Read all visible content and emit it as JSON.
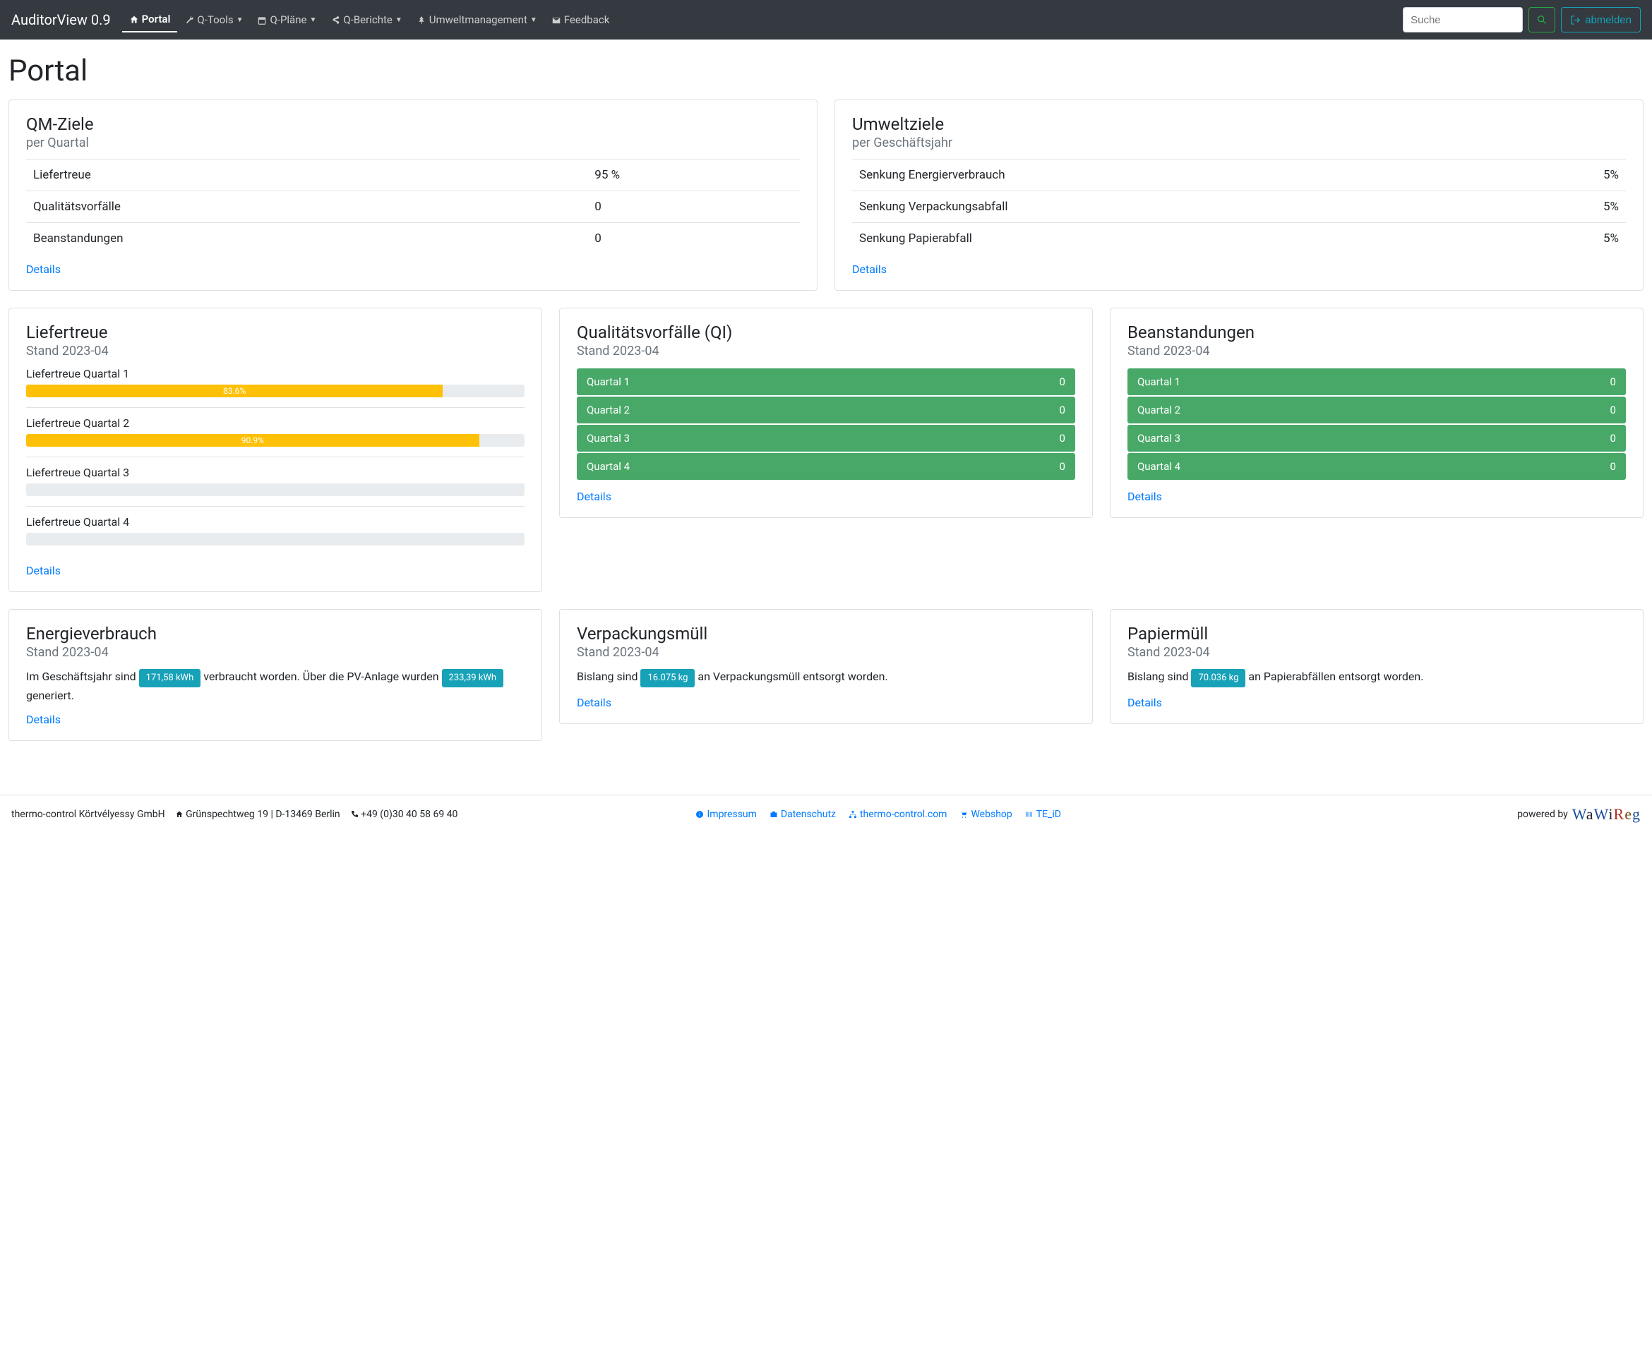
{
  "nav": {
    "brand": "AuditorView 0.9",
    "items": [
      {
        "label": "Portal",
        "icon": "home"
      },
      {
        "label": "Q-Tools",
        "icon": "wrench",
        "dropdown": true
      },
      {
        "label": "Q-Pläne",
        "icon": "calendar",
        "dropdown": true
      },
      {
        "label": "Q-Berichte",
        "icon": "share",
        "dropdown": true
      },
      {
        "label": "Umweltmanagement",
        "icon": "tree",
        "dropdown": true
      },
      {
        "label": "Feedback",
        "icon": "mail"
      }
    ],
    "search_placeholder": "Suche",
    "logout": "abmelden"
  },
  "page_title": "Portal",
  "qm_ziele": {
    "title": "QM-Ziele",
    "subtitle": "per Quartal",
    "rows": [
      {
        "label": "Liefertreue",
        "value": "95 %"
      },
      {
        "label": "Qualitätsvorfälle",
        "value": "0"
      },
      {
        "label": "Beanstandungen",
        "value": "0"
      }
    ],
    "details": "Details"
  },
  "umweltziele": {
    "title": "Umweltziele",
    "subtitle": "per Geschäftsjahr",
    "rows": [
      {
        "label": "Senkung Energierverbrauch",
        "value": "5%"
      },
      {
        "label": "Senkung Verpackungsabfall",
        "value": "5%"
      },
      {
        "label": "Senkung Papierabfall",
        "value": "5%"
      }
    ],
    "details": "Details"
  },
  "liefertreue": {
    "title": "Liefertreue",
    "subtitle": "Stand 2023-04",
    "q1_label": "Liefertreue Quartal 1",
    "q1_pct": 83.6,
    "q1_text": "83.6%",
    "q2_label": "Liefertreue Quartal 2",
    "q2_pct": 90.9,
    "q2_text": "90.9%",
    "q3_label": "Liefertreue Quartal 3",
    "q3_pct": 0,
    "q3_text": "",
    "q4_label": "Liefertreue Quartal 4",
    "q4_pct": 0,
    "q4_text": "",
    "details": "Details"
  },
  "qi": {
    "title": "Qualitätsvorfälle (QI)",
    "subtitle": "Stand 2023-04",
    "rows": [
      {
        "label": "Quartal 1",
        "value": "0"
      },
      {
        "label": "Quartal 2",
        "value": "0"
      },
      {
        "label": "Quartal 3",
        "value": "0"
      },
      {
        "label": "Quartal 4",
        "value": "0"
      }
    ],
    "details": "Details"
  },
  "beanst": {
    "title": "Beanstandungen",
    "subtitle": "Stand 2023-04",
    "rows": [
      {
        "label": "Quartal 1",
        "value": "0"
      },
      {
        "label": "Quartal 2",
        "value": "0"
      },
      {
        "label": "Quartal 3",
        "value": "0"
      },
      {
        "label": "Quartal 4",
        "value": "0"
      }
    ],
    "details": "Details"
  },
  "energie": {
    "title": "Energieverbrauch",
    "subtitle": "Stand 2023-04",
    "text_a": "Im Geschäftsjahr sind ",
    "badge_a": "171,58 kWh",
    "text_b": " verbraucht worden. Über die PV-Anlage wurden ",
    "badge_b": "233,39 kWh",
    "text_c": " generiert.",
    "details": "Details"
  },
  "verpackung": {
    "title": "Verpackungsmüll",
    "subtitle": "Stand 2023-04",
    "text_a": "Bislang sind ",
    "badge": "16.075 kg",
    "text_b": " an Verpackungsmüll entsorgt worden.",
    "details": "Details"
  },
  "papier": {
    "title": "Papiermüll",
    "subtitle": "Stand 2023-04",
    "text_a": "Bislang sind ",
    "badge": "70.036 kg",
    "text_b": " an Papierabfällen entsorgt worden.",
    "details": "Details"
  },
  "footer": {
    "company": "thermo-control Körtvélyessy GmbH",
    "address": "Grünspechtweg 19 | D-13469 Berlin",
    "phone": "+49 (0)30 40 58 69 40",
    "links": {
      "impressum": "Impressum",
      "datenschutz": "Datenschutz",
      "thermo": "thermo-control.com",
      "webshop": "Webshop",
      "teid": "TE_iD"
    },
    "powered": "powered by"
  },
  "chart_data": {
    "type": "bar",
    "title": "Liefertreue",
    "subtitle": "Stand 2023-04",
    "categories": [
      "Quartal 1",
      "Quartal 2",
      "Quartal 3",
      "Quartal 4"
    ],
    "values": [
      83.6,
      90.9,
      0,
      0
    ],
    "ylim": [
      0,
      100
    ],
    "ylabel": "%"
  }
}
